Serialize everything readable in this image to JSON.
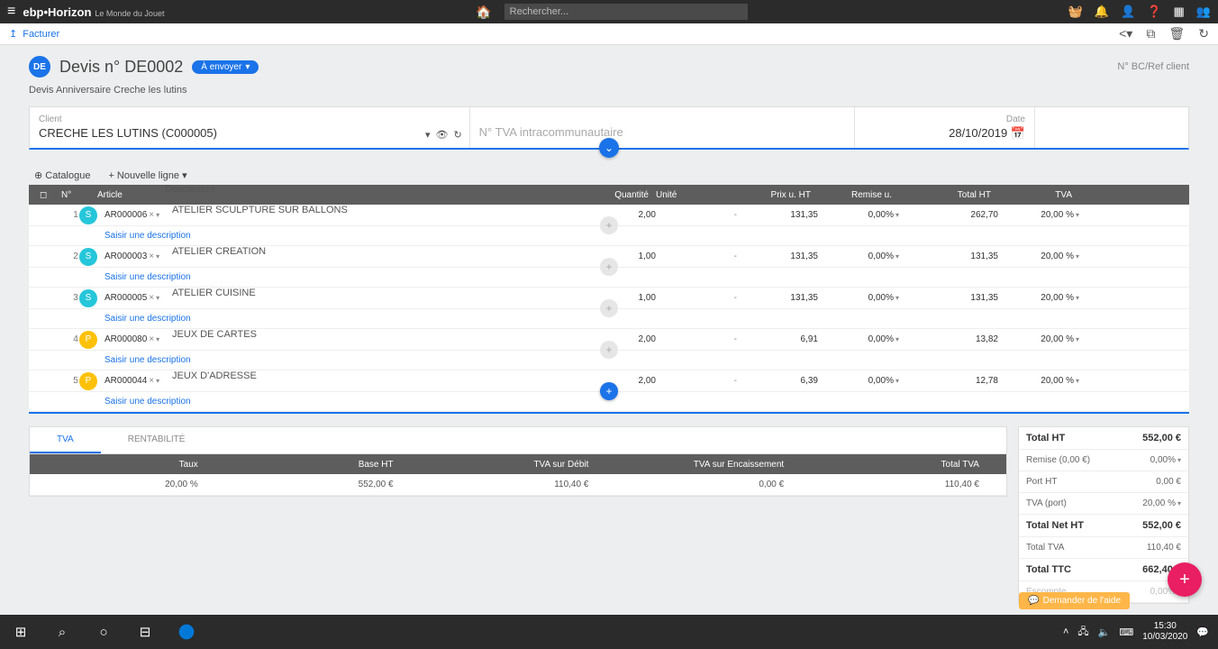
{
  "topbar": {
    "brand": "ebp•Horizon",
    "brand_sub": "Le Monde du Jouet",
    "search_placeholder": "Rechercher..."
  },
  "subbar": {
    "facturer": "Facturer"
  },
  "title": {
    "avatar": "DE",
    "text": "Devis n° DE0002",
    "status": "À envoyer",
    "ref": "N° BC/Ref client"
  },
  "description": "Devis Anniversaire Creche les lutins",
  "form": {
    "client_label": "Client",
    "client_value": "CRECHE LES LUTINS (C000005)",
    "tva_placeholder": "N° TVA intracommunautaire",
    "date_label": "Date",
    "date_value": "28/10/2019"
  },
  "toolbar": {
    "catalogue": "Catalogue",
    "nouvelle_ligne": "Nouvelle ligne"
  },
  "grid": {
    "headers": {
      "num": "N°",
      "article": "Article",
      "description": "Description",
      "quantite": "Quantité",
      "unite": "Unité",
      "pu": "Prix u. HT",
      "remise": "Remise u.",
      "total": "Total HT",
      "tva": "TVA"
    },
    "desc_placeholder": "Saisir une description",
    "rows": [
      {
        "n": "1",
        "type": "S",
        "code": "AR000006",
        "desc": "ATELIER SCULPTURE SUR BALLONS",
        "qty": "2,00",
        "unit": "-",
        "pu": "131,35",
        "rem": "0,00%",
        "tot": "262,70",
        "tva": "20,00 %"
      },
      {
        "n": "2",
        "type": "S",
        "code": "AR000003",
        "desc": "ATELIER CREATION",
        "qty": "1,00",
        "unit": "-",
        "pu": "131,35",
        "rem": "0,00%",
        "tot": "131,35",
        "tva": "20,00 %"
      },
      {
        "n": "3",
        "type": "S",
        "code": "AR000005",
        "desc": "ATELIER CUISINE",
        "qty": "1,00",
        "unit": "-",
        "pu": "131,35",
        "rem": "0,00%",
        "tot": "131,35",
        "tva": "20,00 %"
      },
      {
        "n": "4",
        "type": "P",
        "code": "AR000080",
        "desc": "JEUX DE CARTES",
        "qty": "2,00",
        "unit": "-",
        "pu": "6,91",
        "rem": "0,00%",
        "tot": "13,82",
        "tva": "20,00 %"
      },
      {
        "n": "5",
        "type": "P",
        "code": "AR000044",
        "desc": "JEUX D'ADRESSE",
        "qty": "2,00",
        "unit": "-",
        "pu": "6,39",
        "rem": "0,00%",
        "tot": "12,78",
        "tva": "20,00 %"
      }
    ]
  },
  "tabs": {
    "tva": "TVA",
    "rentabilite": "RENTABILITÉ"
  },
  "tvatable": {
    "headers": {
      "taux": "Taux",
      "base": "Base HT",
      "debit": "TVA sur Débit",
      "enc": "TVA sur Encaissement",
      "total": "Total TVA"
    },
    "row": {
      "taux": "20,00 %",
      "base": "552,00 €",
      "debit": "110,40 €",
      "enc": "0,00 €",
      "total": "110,40 €"
    }
  },
  "totals": {
    "total_ht_label": "Total HT",
    "total_ht": "552,00 €",
    "remise_label": "Remise (0,00 €)",
    "remise": "0,00%",
    "port_label": "Port HT",
    "port": "0,00 €",
    "tvaport_label": "TVA (port)",
    "tvaport": "20,00 %",
    "net_label": "Total Net HT",
    "net": "552,00 €",
    "tottva_label": "Total TVA",
    "tottva": "110,40 €",
    "ttc_label": "Total TTC",
    "ttc": "662,40 €",
    "escompte_label": "Escompte",
    "escompte": "0,00%"
  },
  "help": "Demander de l'aide",
  "taskbar": {
    "time": "15:30",
    "date": "10/03/2020"
  }
}
